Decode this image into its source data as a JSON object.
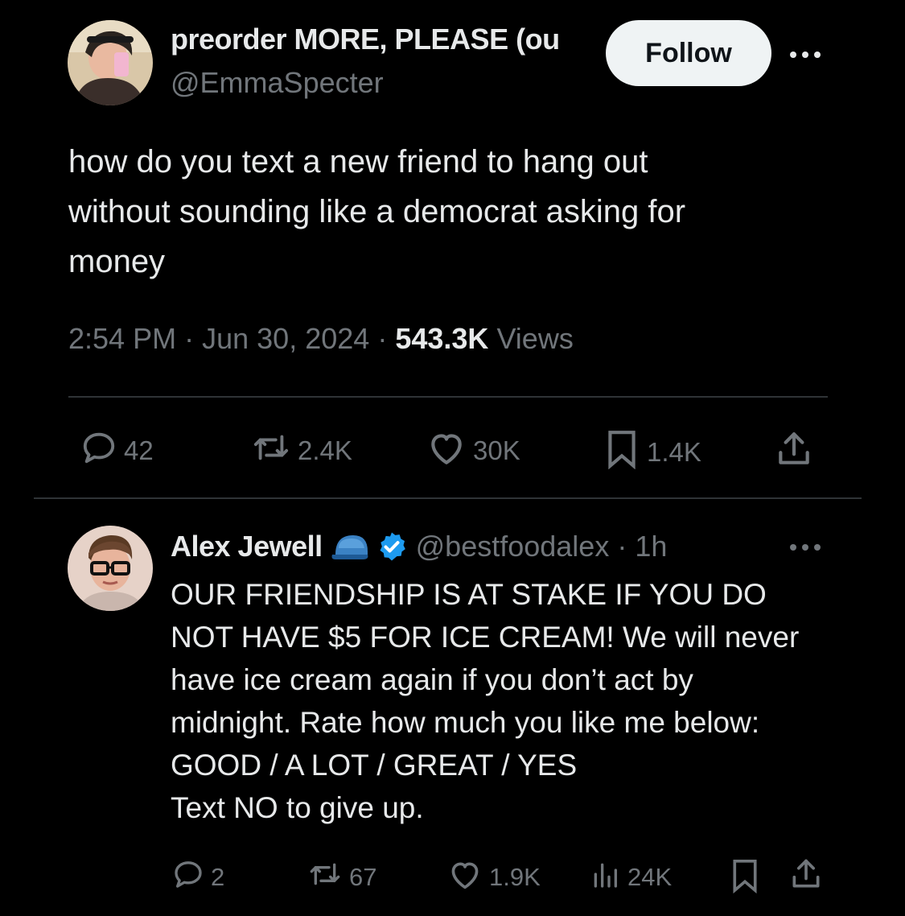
{
  "tweet": {
    "author": {
      "display_name": "preorder MORE, PLEASE (ou",
      "handle": "@EmmaSpecter",
      "avatar_icon": "profile-photo"
    },
    "follow_label": "Follow",
    "text": "how do you text a new friend to hang out\nwithout sounding like a democrat asking for\nmoney",
    "time": "2:54 PM",
    "date": "Jun 30, 2024",
    "separator": "·",
    "views_count": "543.3K",
    "views_label": "Views",
    "actions": {
      "replies": "42",
      "reposts": "2.4K",
      "likes": "30K",
      "bookmarks": "1.4K"
    }
  },
  "reply": {
    "author": {
      "display_name": "Alex Jewell",
      "handle_time": "@bestfoodalex · 1h",
      "verified": true,
      "avatar_icon": "profile-photo"
    },
    "text": "OUR FRIENDSHIP IS AT STAKE IF YOU DO\nNOT HAVE $5 FOR ICE CREAM! We will never\nhave ice cream again if you don’t act by\nmidnight. Rate how much you like me below:\nGOOD / A LOT / GREAT / YES\nText NO to give up.",
    "actions": {
      "replies": "2",
      "reposts": "67",
      "likes": "1.9K",
      "views": "24K"
    }
  },
  "colors": {
    "background": "#000000",
    "text_primary": "#e7e9ea",
    "text_secondary": "#71767b",
    "divider": "#2f3336",
    "verified": "#1d9bf0",
    "follow_bg": "#eff3f4"
  }
}
